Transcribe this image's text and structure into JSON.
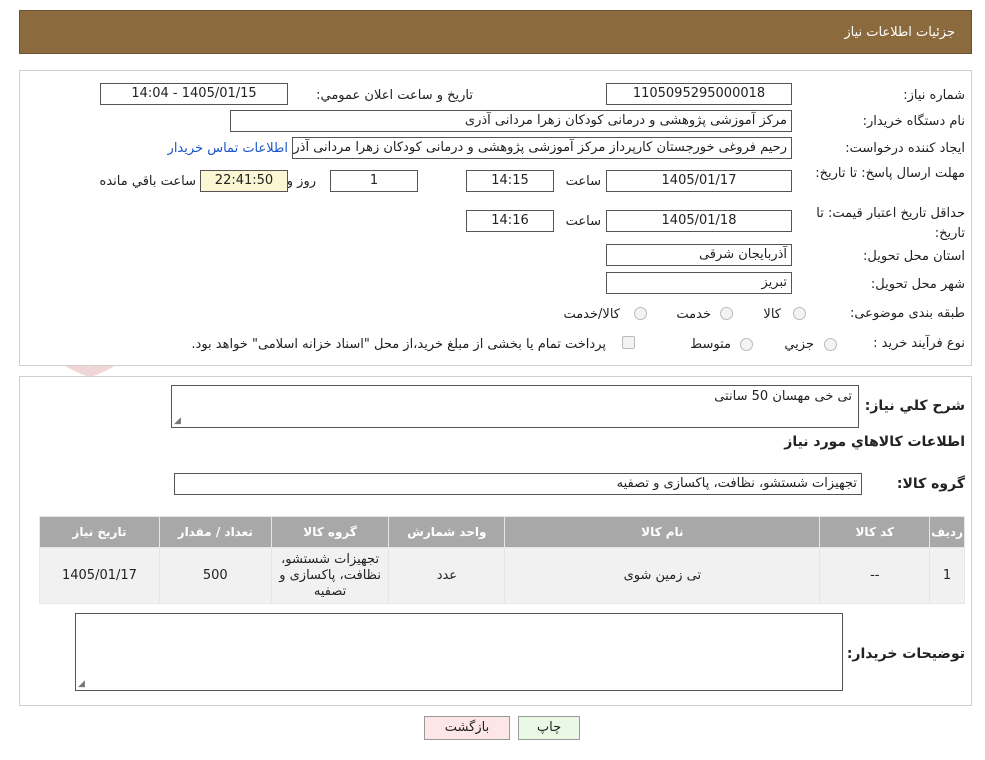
{
  "page_title": "جزئیات اطلاعات نیاز",
  "fields": {
    "need_number_label": "شماره نیاز:",
    "need_number": "1105095295000018",
    "announce_label": "تاریخ و ساعت اعلان عمومي:",
    "announce_value": "1405/01/15 - 14:04",
    "buyer_org_label": "نام دستگاه خريدار:",
    "buyer_org": "مرکز آموزشی پژوهشی و درمانی کودکان زهرا مردانی آذری",
    "requester_label": "ايجاد کننده درخواست:",
    "requester": "رحیم فروغی خورجستان کارپرداز مرکز آموزشی پژوهشی و درمانی کودکان زهرا مردانی آذری",
    "contact_link": "اطلاعات تماس خريدار",
    "deadline_label": "مهلت ارسال پاسخ: تا تاریخ:",
    "deadline_date": "1405/01/17",
    "time_label": "ساعت",
    "deadline_time": "14:15",
    "days_value": "1",
    "days_label": "روز و",
    "remaining_time": "22:41:50",
    "remaining_label": "ساعت باقي مانده",
    "validity_label": "حداقل تاريخ اعتبار قيمت: تا تاریخ:",
    "validity_date": "1405/01/18",
    "validity_time": "14:16",
    "province_label": "استان محل تحويل:",
    "province": "آذربايجان شرقی",
    "city_label": "شهر محل تحويل:",
    "city": "تبریز",
    "category_label": "طبقه بندی موضوعی:",
    "category_options": [
      "کالا",
      "خدمت",
      "کالا/خدمت"
    ],
    "purchase_label": "نوع فرآيند خريد :",
    "purchase_options": [
      "جزيي",
      "متوسط"
    ],
    "payment_note": "پرداخت تمام یا بخشی از مبلغ خرید،از محل \"اسناد خزانه اسلامی\" خواهد بود."
  },
  "watermark_text": "AriaTender.neT",
  "details": {
    "summary_label": "شرح کلي نياز:",
    "summary": "تی خی مهسان 50 سانتی",
    "goods_info_title": "اطلاعات کالاهاي مورد نياز",
    "goods_group_label": "گروه کالا:",
    "goods_group": "تجهیزات شستشو، نظافت، پاکسازی و تصفیه",
    "table": {
      "headers": [
        "رديف",
        "کد کالا",
        "نام کالا",
        "واحد شمارش",
        "گروه کالا",
        "تعداد / مقدار",
        "تاریخ نیاز"
      ],
      "rows": [
        [
          "1",
          "--",
          "تی زمین شوی",
          "عدد",
          "تجهیزات شستشو، نظافت، پاکسازی و تصفیه",
          "500",
          "1405/01/17"
        ]
      ]
    },
    "buyer_notes_label": "توضيحات خريدار:",
    "buyer_notes": ""
  },
  "buttons": {
    "print": "چاپ",
    "back": "بازگشت"
  },
  "colors": {
    "header_bg": "#8b6a3e",
    "link": "#1a56c8",
    "table_header_bg": "#a8a8a8",
    "back_button_bg": "#fde6e6",
    "print_button_bg": "#eaf9e6"
  }
}
